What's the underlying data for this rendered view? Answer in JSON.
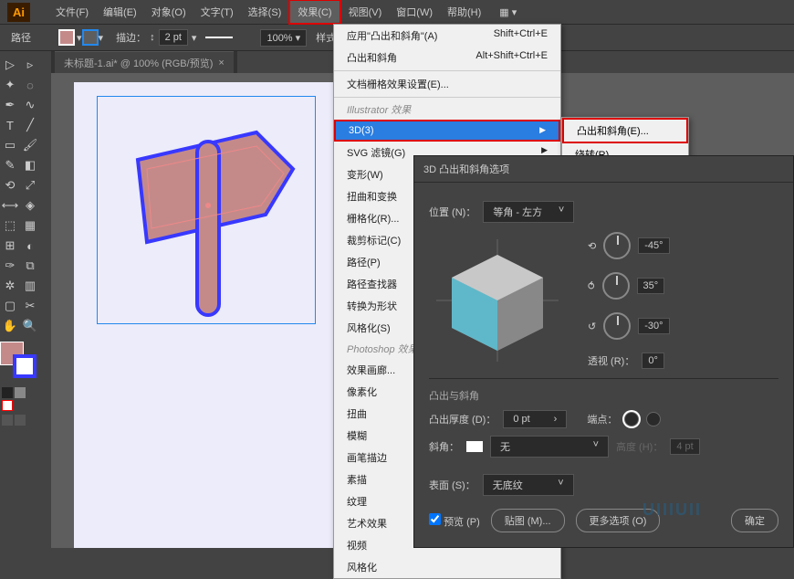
{
  "app": {
    "logo": "Ai"
  },
  "menu": {
    "items": [
      "文件(F)",
      "编辑(E)",
      "对象(O)",
      "文字(T)",
      "选择(S)",
      "效果(C)",
      "视图(V)",
      "窗口(W)",
      "帮助(H)"
    ],
    "active_index": 5
  },
  "options": {
    "path_label": "路径",
    "stroke_label": "描边：",
    "stroke_val": "2 pt",
    "zoom": "100%",
    "style_label": "样式："
  },
  "tab": {
    "title": "未标题-1.ai* @ 100% (RGB/预览)"
  },
  "dropdown": {
    "top": [
      {
        "label": "应用\"凸出和斜角\"(A)",
        "shortcut": "Shift+Ctrl+E"
      },
      {
        "label": "凸出和斜角",
        "shortcut": "Alt+Shift+Ctrl+E"
      }
    ],
    "doc_grid": "文档栅格效果设置(E)...",
    "ill_head": "Illustrator 效果",
    "ill_items": [
      "3D(3)",
      "SVG 滤镜(G)",
      "变形(W)",
      "扭曲和变换",
      "栅格化(R)...",
      "裁剪标记(C)",
      "路径(P)",
      "路径查找器",
      "转换为形状",
      "风格化(S)"
    ],
    "ps_head": "Photoshop 效果",
    "ps_items": [
      "效果画廊...",
      "像素化",
      "扭曲",
      "模糊",
      "画笔描边",
      "素描",
      "纹理",
      "艺术效果",
      "视频",
      "风格化"
    ]
  },
  "sub_menu": {
    "items": [
      "凸出和斜角(E)...",
      "绕转(R)..."
    ]
  },
  "dialog": {
    "title": "3D 凸出和斜角选项",
    "position_label": "位置 (N)：",
    "position_val": "等角 - 左方",
    "rot": [
      "-45°",
      "35°",
      "-30°"
    ],
    "perspective_label": "透视 (R)：",
    "perspective_val": "0°",
    "extrude_section": "凸出与斜角",
    "depth_label": "凸出厚度 (D)：",
    "depth_val": "0 pt",
    "cap_label": "端点：",
    "bevel_label": "斜角：",
    "bevel_val": "无",
    "height_label": "高度 (H)：",
    "height_val": "4 pt",
    "surface_label": "表面 (S)：",
    "surface_val": "无底纹",
    "preview": "预览 (P)",
    "map_art": "贴图 (M)...",
    "more_opts": "更多选项 (O)",
    "ok": "确定"
  },
  "watermark": "UIIIUII"
}
